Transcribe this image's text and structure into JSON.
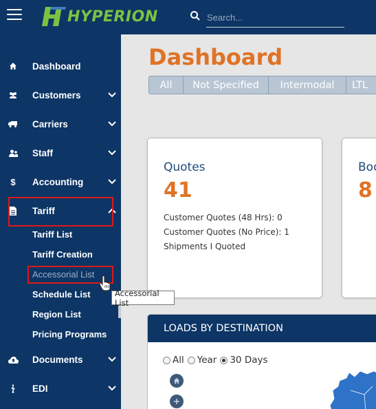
{
  "header": {
    "app_name": "HYPERION",
    "search_placeholder": "Search..."
  },
  "sidebar": {
    "items": [
      {
        "label": "Dashboard",
        "icon": "home-icon"
      },
      {
        "label": "Customers",
        "icon": "users-icon"
      },
      {
        "label": "Carriers",
        "icon": "truck-icon"
      },
      {
        "label": "Staff",
        "icon": "staff-icon"
      },
      {
        "label": "Accounting",
        "icon": "dollar-icon"
      },
      {
        "label": "Tariff",
        "icon": "document-icon"
      },
      {
        "label": "Documents",
        "icon": "cloud-upload-icon"
      },
      {
        "label": "EDI",
        "icon": "usb-icon"
      }
    ],
    "tariff_submenu": [
      "Tariff List",
      "Tariff Creation",
      "Accessorial List",
      "Schedule List",
      "Region List",
      "Pricing Programs"
    ],
    "active_subitem": "Accessorial List"
  },
  "main": {
    "title": "Dashboard",
    "filters": [
      "All",
      "Not Specified",
      "Intermodal",
      "LTL"
    ],
    "quotes_card": {
      "title": "Quotes",
      "value": "41",
      "lines": [
        "Customer Quotes (48 Hrs): 0",
        "Customer Quotes (No Price): 1",
        "Shipments I Quoted"
      ]
    },
    "booked_card": {
      "title": "Boo",
      "value": "8"
    },
    "loads": {
      "title": "LOADS BY DESTINATION",
      "radio_options": [
        "All",
        "Year",
        "30 Days"
      ],
      "selected": "30 Days"
    }
  },
  "tooltip": "Accessorial List",
  "colors": {
    "navy": "#0d3565",
    "accent_orange": "#e07326",
    "logo_green": "#7cc242",
    "highlight_red": "#e01818"
  }
}
